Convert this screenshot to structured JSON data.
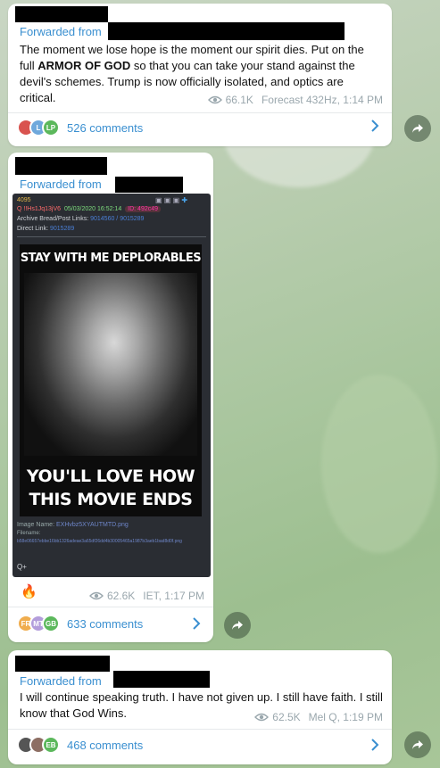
{
  "posts": [
    {
      "forwarded_label": "Forwarded from",
      "text_parts": [
        "The moment we lose hope is the moment our spirit dies. Put on the full ",
        "ARMOR OF GOD",
        " so that you can take your stand against the devil's schemes. Trump is now officially isolated, and optics are critical."
      ],
      "views": "66.1K",
      "author_time": "Forecast 432Hz, 1:14 PM",
      "avatars": [
        {
          "initials": "",
          "color": "#d9534f"
        },
        {
          "initials": "L",
          "color": "#6fa8dc"
        },
        {
          "initials": "LP",
          "color": "#5cb85c"
        }
      ],
      "comments": "526 comments"
    },
    {
      "forwarded_label": "Forwarded from",
      "image": {
        "post_number": "4095",
        "q_line": "Q  !!Hs1Jq13jV6",
        "date": "05/03/2020 16:52:14",
        "id_tag": "ID: 492c49",
        "archive_label": "Archive Bread/Post Links:",
        "archive_links": "9014560 / 9015289",
        "direct_label": "Direct Link:",
        "direct_link": "9015289",
        "meme_top": "STAY WITH ME DEPLORABLES",
        "meme_bottom_1": "YOU'LL LOVE HOW",
        "meme_bottom_2": "THIS MOVIE ENDS",
        "image_name_label": "Image Name:",
        "image_name": "EXHvbz5XYAUTMTD.png",
        "filename_label": "Filename:",
        "filename": "b58e06657ebbe16bb1326adeae3a65df26dd4b30005465a1987b3aeb1bad8d0f.png",
        "footer": "Q+"
      },
      "reaction": "🔥",
      "views": "62.6K",
      "author_time": "IET, 1:17 PM",
      "avatars": [
        {
          "initials": "FR",
          "color": "#f0ad4e"
        },
        {
          "initials": "MT",
          "color": "#b39ddb"
        },
        {
          "initials": "GB",
          "color": "#5cb85c"
        }
      ],
      "comments": "633 comments"
    },
    {
      "forwarded_label": "Forwarded from",
      "text": "I will continue speaking truth. I have not given up. I still have faith. I still know that God Wins.",
      "views": "62.5K",
      "author_time": "Mel Q, 1:19 PM",
      "avatars": [
        {
          "initials": "",
          "color": "#555"
        },
        {
          "initials": "",
          "color": "#8d6e63"
        },
        {
          "initials": "EB",
          "color": "#5cb85c"
        }
      ],
      "comments": "468 comments"
    }
  ],
  "icons": {
    "views": "eye-icon",
    "chevron": "chevron-right-icon",
    "share": "share-arrow-icon"
  }
}
